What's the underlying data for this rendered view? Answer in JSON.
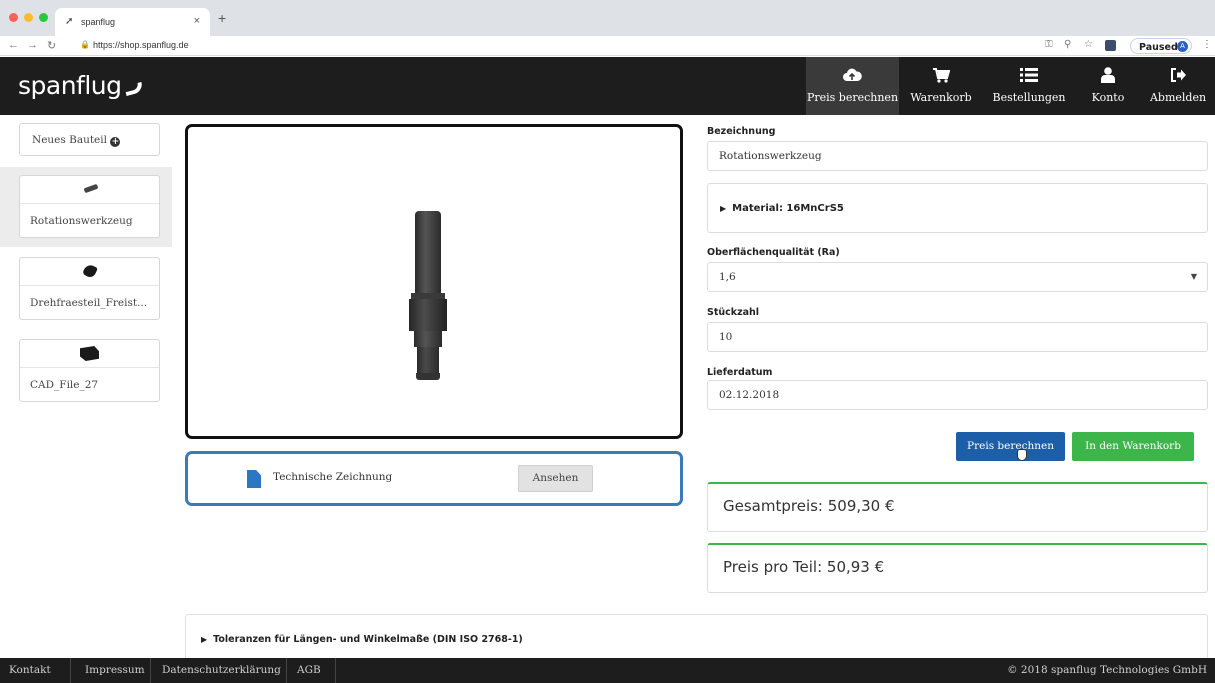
{
  "browser": {
    "tab_title": "spanflug",
    "tab_close": "×",
    "new_tab": "+",
    "url": "https://shop.spanflug.de",
    "profile_status": "Paused",
    "profile_initial": "A"
  },
  "app": {
    "logo": "spanflug",
    "nav": [
      {
        "label": "Preis berechnen",
        "icon": "cloud-upload-icon"
      },
      {
        "label": "Warenkorb",
        "icon": "cart-icon"
      },
      {
        "label": "Bestellungen",
        "icon": "list-icon"
      },
      {
        "label": "Konto",
        "icon": "user-icon"
      },
      {
        "label": "Abmelden",
        "icon": "sign-out-icon"
      }
    ]
  },
  "sidebar": {
    "new_part": "Neues Bauteil",
    "parts": [
      {
        "name": "Rotationswerkzeug"
      },
      {
        "name": "Drehfraesteil_Freist..."
      },
      {
        "name": "CAD_File_27"
      }
    ]
  },
  "viewer": {
    "drawing_label": "Technische Zeichnung",
    "view_button": "Ansehen"
  },
  "form": {
    "name_label": "Bezeichnung",
    "name_value": "Rotationswerkzeug",
    "material": "Material: 16MnCrS5",
    "surface_label": "Oberflächenqualität (Ra)",
    "surface_value": "1,6",
    "qty_label": "Stückzahl",
    "qty_value": "10",
    "date_label": "Lieferdatum",
    "date_value": "02.12.2018",
    "calc_button": "Preis berechnen",
    "cart_button": "In den Warenkorb",
    "total_price": "Gesamtpreis: 509,30 €",
    "unit_price": "Preis pro Teil: 50,93 €",
    "tolerances": "Toleranzen für Längen- und Winkelmaße (DIN ISO 2768-1)"
  },
  "footer": {
    "links": [
      "Kontakt",
      "Impressum",
      "Datenschutzerklärung",
      "AGB"
    ],
    "copyright": "© 2018 spanflug Technologies GmbH"
  },
  "colors": {
    "header_bg": "#1d1d1d",
    "primary_blue": "#1c5fa8",
    "success_green": "#3cb54a"
  }
}
